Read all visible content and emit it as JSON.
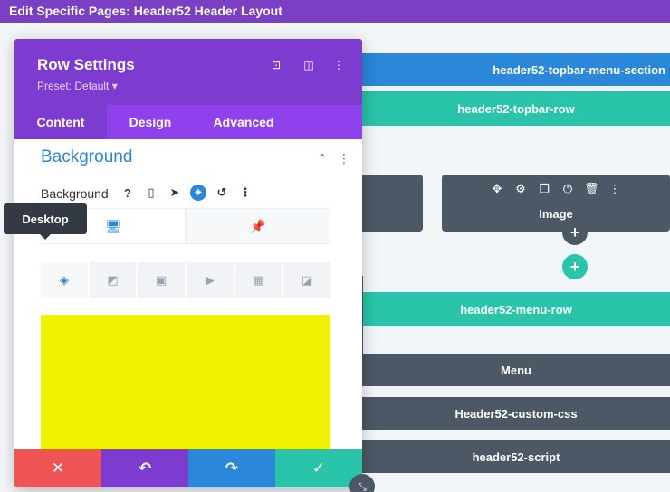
{
  "page_title": "Edit Specific Pages: Header52 Header Layout",
  "canvas": {
    "section_label": "header52-topbar-menu-section",
    "topbar_row_label": "header52-topbar-row",
    "image_module_label": "Image",
    "menu_row_label": "header52-menu-row",
    "menu_module_label": "Menu",
    "custom_css_label": "Header52-custom-css",
    "script_label": "header52-script",
    "add_symbol": "+"
  },
  "modal": {
    "title": "Row Settings",
    "preset": "Preset: Default ▾",
    "header_icons": [
      "focus-icon",
      "sidebar-icon",
      "more-icon"
    ],
    "tabs": [
      {
        "label": "Content",
        "active": true
      },
      {
        "label": "Design",
        "active": false
      },
      {
        "label": "Advanced",
        "active": false
      }
    ],
    "group_title": "Background",
    "field_label": "Background",
    "tooltip": "Desktop",
    "swatch_color": "#eef200"
  },
  "footer": {
    "cancel": "✕",
    "undo": "↶",
    "redo": "↷",
    "save": "✓"
  },
  "colors": {
    "purple": "#7e3bd0",
    "teal": "#29c4a9",
    "blue": "#2b87da",
    "dark": "#4c5866",
    "red": "#ef5555"
  }
}
